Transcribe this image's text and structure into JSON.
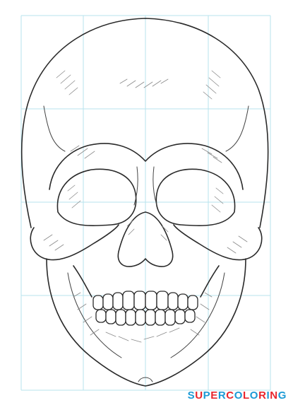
{
  "logo": {
    "text": "SUPERCOLORING",
    "colors": [
      "#1b9ad6",
      "#e9262d",
      "#1b9ad6",
      "#e9262d",
      "#1b9ad6",
      "#e9262d",
      "#1b9ad6",
      "#e9262d",
      "#1b9ad6",
      "#e9262d",
      "#1b9ad6",
      "#e9262d",
      "#1b9ad6"
    ]
  },
  "colors": {
    "grid": "#b7e3ee",
    "ink": "#2a2a2a",
    "shading": "#8a8a8a",
    "background": "#ffffff"
  }
}
